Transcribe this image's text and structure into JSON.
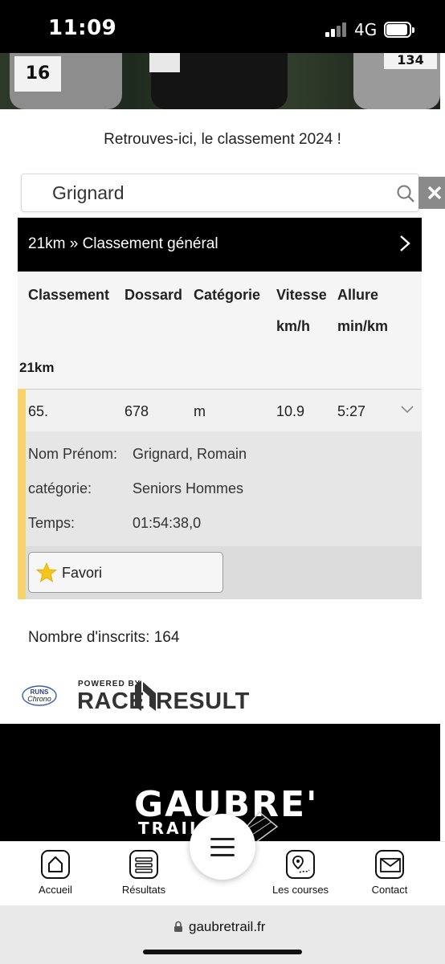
{
  "status_bar": {
    "time": "11:09",
    "network": "4G"
  },
  "hero": {
    "bibs": [
      "16",
      "134"
    ]
  },
  "intro_text": "Retrouves-ici, le classement 2024 !",
  "search": {
    "value": "Grignard"
  },
  "result_header": {
    "title": "21km » Classement général"
  },
  "table": {
    "columns": [
      {
        "label": "Classement",
        "unit": ""
      },
      {
        "label": "Dossard",
        "unit": ""
      },
      {
        "label": "Catégorie",
        "unit": ""
      },
      {
        "label": "Vitesse",
        "unit": "km/h"
      },
      {
        "label": "Allure",
        "unit": "min/km"
      }
    ],
    "group": "21km",
    "row": {
      "classement": "65.",
      "dossard": "678",
      "categorie": "m",
      "vitesse": "10.9",
      "allure": "5:27"
    }
  },
  "details": {
    "name_label": "Nom Prénom:",
    "name_value": "Grignard, Romain",
    "category_label": "catégorie:",
    "category_value": "Seniors Hommes",
    "time_label": "Temps:",
    "time_value": "01:54:38,0"
  },
  "favorite": {
    "label": "Favori"
  },
  "inscrits": "Nombre d'inscrits: 164",
  "sponsor": {
    "chrono_logo": "RUNS Chrono",
    "powered_by": "POWERED BY",
    "race": "RACE",
    "result": "RESULT"
  },
  "banner": {
    "title": "GAUBRE'",
    "subtitle": "TRAIL"
  },
  "bottom_nav": {
    "items": [
      {
        "label": "Accueil",
        "icon": "home-icon"
      },
      {
        "label": "Résultats",
        "icon": "results-icon"
      },
      {
        "label": "Les courses",
        "icon": "map-icon"
      },
      {
        "label": "Contact",
        "icon": "mail-icon"
      }
    ],
    "menu_icon": "hamburger-menu-icon"
  },
  "browser": {
    "url": "gaubretrail.fr"
  },
  "colors": {
    "accent": "#f6d36d",
    "header_bg": "#000000",
    "star": "#f5c518"
  }
}
